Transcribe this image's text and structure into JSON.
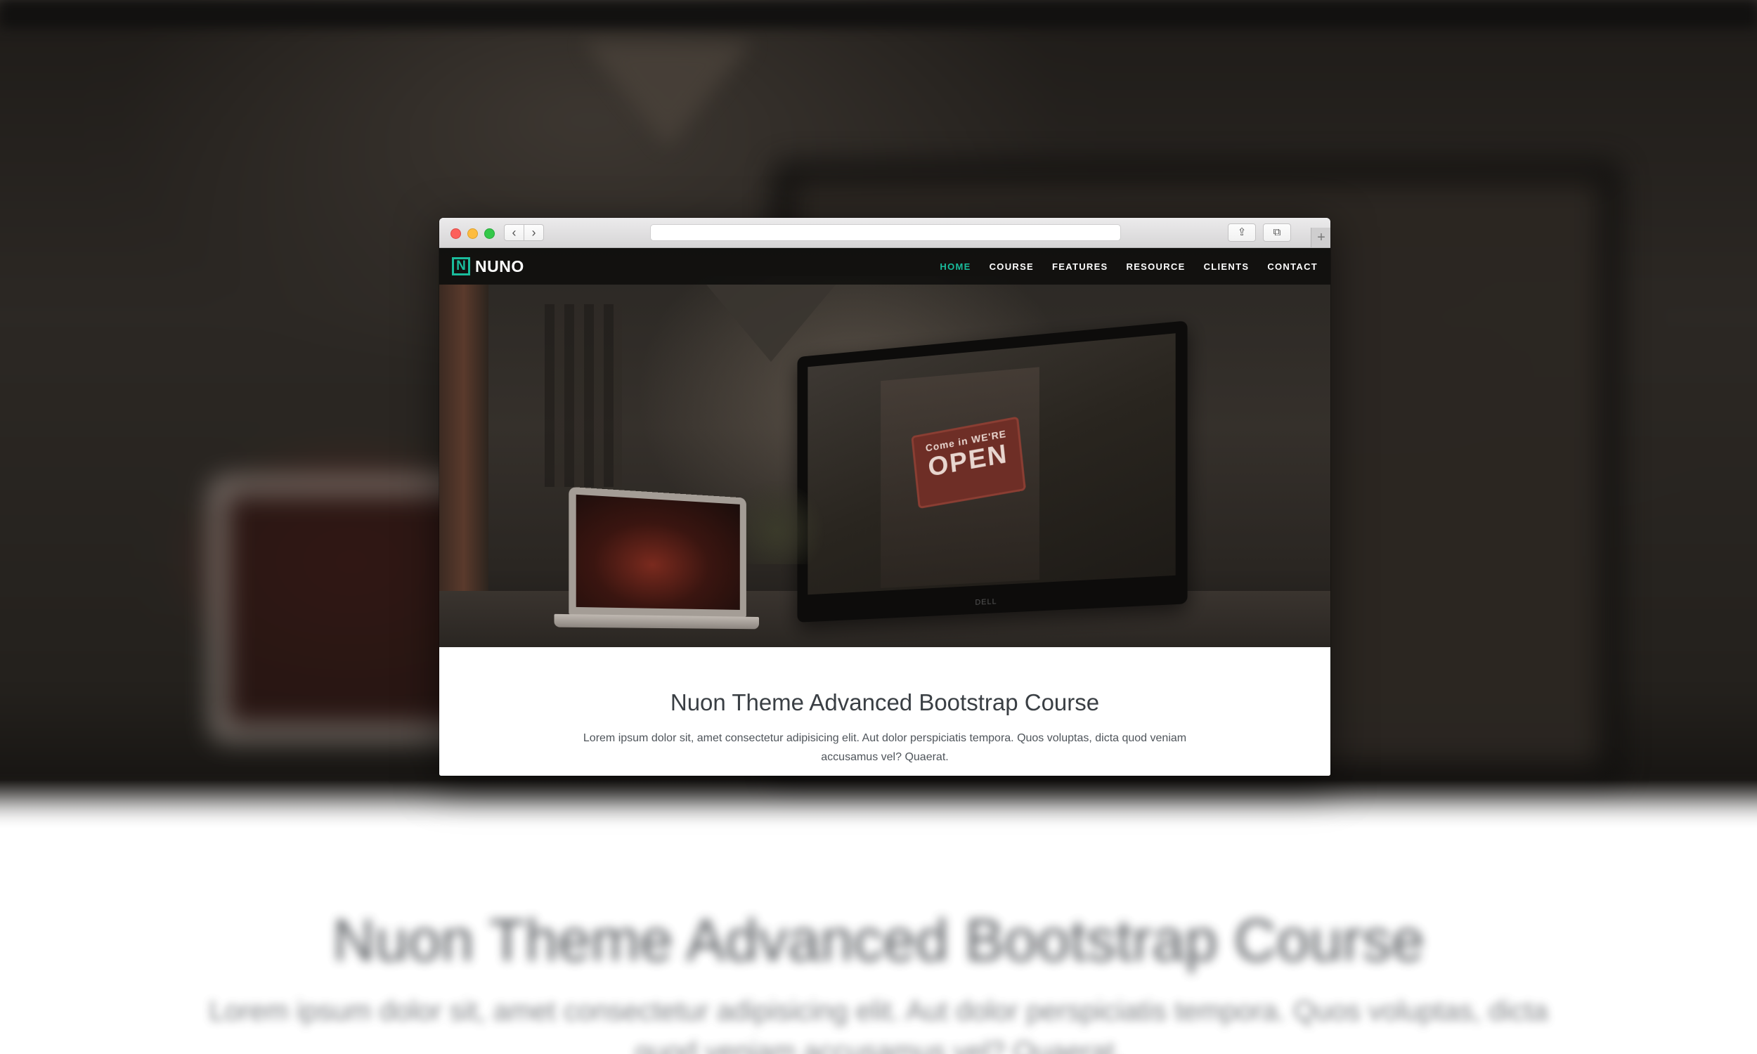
{
  "site": {
    "logo_letter": "N",
    "logo_text": "NUNO",
    "nav": [
      {
        "label": "HOME",
        "active": true
      },
      {
        "label": "COURSE",
        "active": false
      },
      {
        "label": "FEATURES",
        "active": false
      },
      {
        "label": "RESOURCE",
        "active": false
      },
      {
        "label": "CLIENTS",
        "active": false
      },
      {
        "label": "CONTACT",
        "active": false
      }
    ],
    "hero": {
      "sign_small": "Come in WE'RE",
      "sign_big": "OPEN",
      "monitor_brand": "DELL"
    },
    "content": {
      "title": "Nuon Theme Advanced Bootstrap Course",
      "text": "Lorem ipsum dolor sit, amet consectetur adipisicing elit. Aut dolor perspiciatis tempora. Quos voluptas, dicta quod veniam accusamus vel? Quaerat."
    }
  },
  "browser": {
    "back_glyph": "‹",
    "forward_glyph": "›",
    "share_glyph": "⇪",
    "tabs_glyph": "⧉",
    "new_tab_glyph": "+",
    "address_value": ""
  },
  "colors": {
    "accent": "#1abc9c",
    "navbar_bg": "#0c0c0b",
    "title_text": "#3a3f44"
  },
  "icons": [
    "back-arrow-icon",
    "forward-arrow-icon",
    "share-icon",
    "tabs-icon",
    "plus-icon",
    "nuno-logo-icon"
  ]
}
